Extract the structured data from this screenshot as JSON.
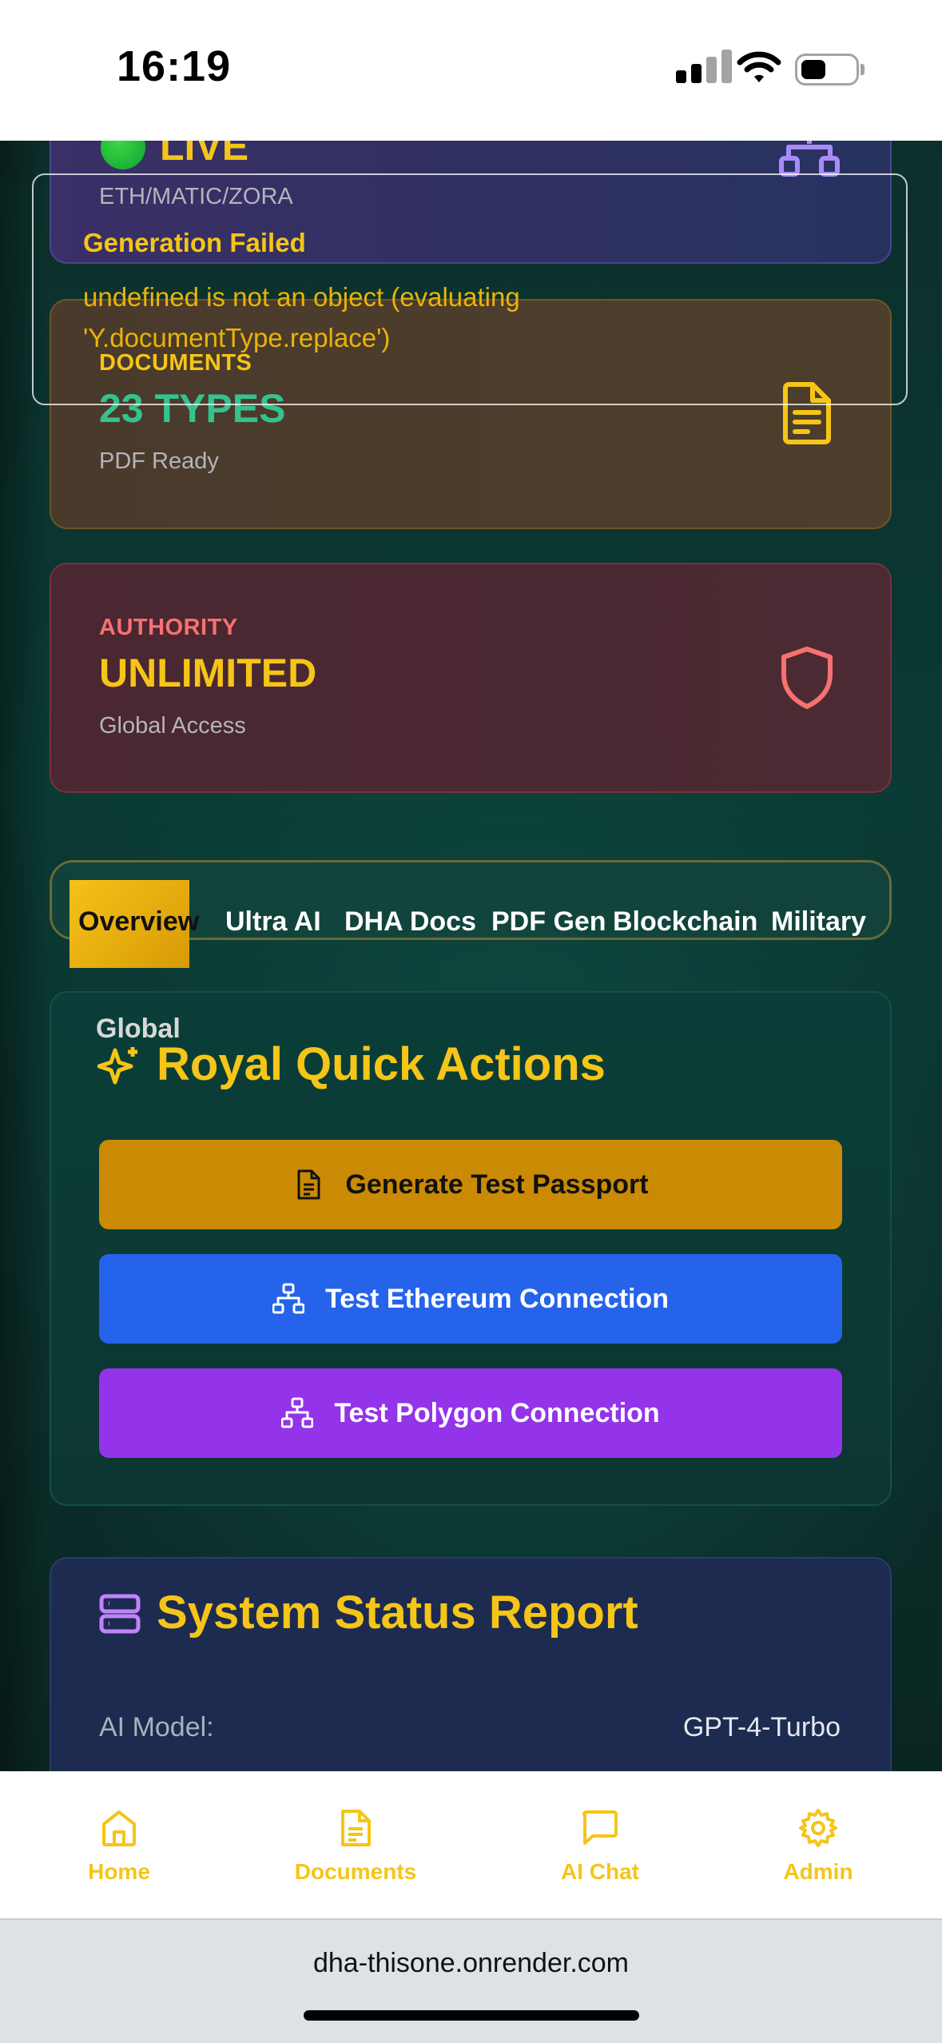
{
  "status_bar": {
    "time": "16:19"
  },
  "cards": {
    "blockchain": {
      "value": "LIVE",
      "sub": "ETH/MATIC/ZORA"
    },
    "documents": {
      "label": "DOCUMENTS",
      "value": "23 TYPES",
      "sub": "PDF Ready"
    },
    "authority": {
      "label": "AUTHORITY",
      "value": "UNLIMITED",
      "sub": "Global Access"
    }
  },
  "error": {
    "title": "Generation Failed",
    "message": "undefined is not an object (evaluating 'Y.documentType.replace')"
  },
  "tabs": [
    {
      "label": "Overview",
      "active": true
    },
    {
      "label": "Ultra AI"
    },
    {
      "label": "DHA Docs"
    },
    {
      "label": "PDF Gen"
    },
    {
      "label": "Blockchain"
    },
    {
      "label": "Military"
    }
  ],
  "quick_actions": {
    "overlay_label": "Global",
    "title": "Royal Quick Actions",
    "buttons": [
      {
        "label": "Generate Test Passport",
        "color": "#ca8a04"
      },
      {
        "label": "Test Ethereum Connection",
        "color": "#2563eb"
      },
      {
        "label": "Test Polygon Connection",
        "color": "#9333ea"
      }
    ]
  },
  "system_status": {
    "title": "System Status Report",
    "rows": [
      {
        "key": "AI Model:",
        "value": "GPT-4-Turbo"
      }
    ]
  },
  "bottom_nav": [
    {
      "label": "Home",
      "icon": "home-icon"
    },
    {
      "label": "Documents",
      "icon": "document-icon"
    },
    {
      "label": "AI Chat",
      "icon": "chat-icon"
    },
    {
      "label": "Admin",
      "icon": "gear-icon"
    }
  ],
  "browser": {
    "url": "dha-thisone.onrender.com"
  },
  "colors": {
    "accent": "#f5c518",
    "success": "#34c38f",
    "danger": "#f87171",
    "blockchain_icon": "#a78bfa"
  }
}
